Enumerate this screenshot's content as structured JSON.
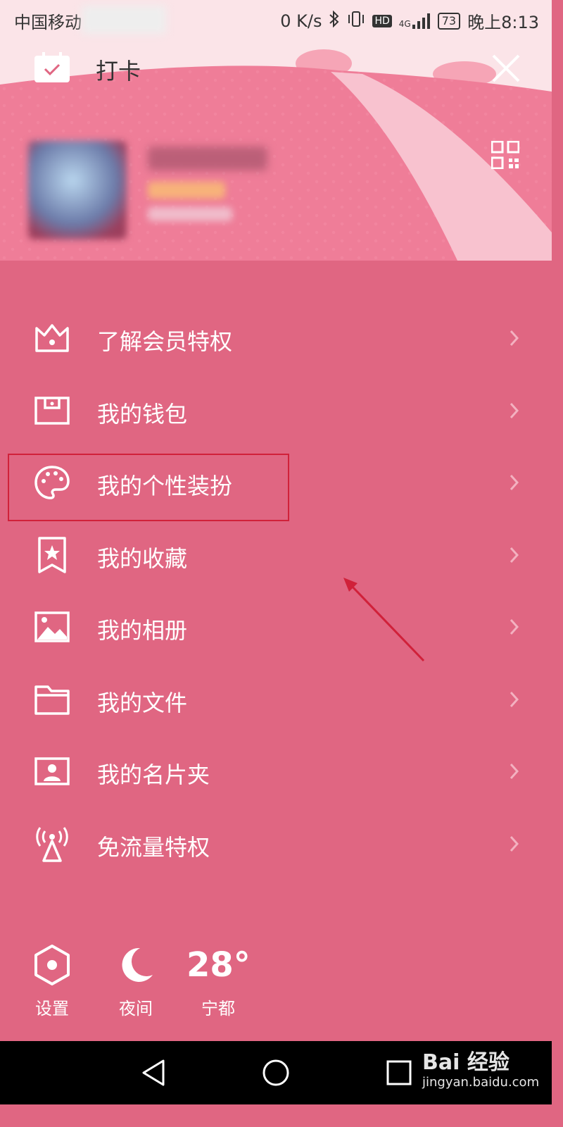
{
  "status_bar": {
    "carrier": "中国移动",
    "net_speed": "0 K/s",
    "hd_badge": "HD",
    "network_type": "4G",
    "battery": "73",
    "time": "晚上8:13"
  },
  "top_bar": {
    "checkin_label": "打卡"
  },
  "menu": {
    "items": [
      {
        "label": "了解会员特权",
        "icon": "crown-icon"
      },
      {
        "label": "我的钱包",
        "icon": "wallet-icon"
      },
      {
        "label": "我的个性装扮",
        "icon": "palette-icon"
      },
      {
        "label": "我的收藏",
        "icon": "bookmark-star-icon"
      },
      {
        "label": "我的相册",
        "icon": "photo-icon"
      },
      {
        "label": "我的文件",
        "icon": "folder-icon"
      },
      {
        "label": "我的名片夹",
        "icon": "contact-card-icon"
      },
      {
        "label": "免流量特权",
        "icon": "antenna-icon"
      }
    ]
  },
  "bottom_bar": {
    "settings_label": "设置",
    "night_label": "夜间",
    "temperature": "28°",
    "city": "宁都"
  },
  "watermark": {
    "brand": "Bai 经验",
    "url": "jingyan.baidu.com"
  },
  "colors": {
    "panel": "#e06682",
    "highlight_box": "#d0213a",
    "arrow": "#d0213a"
  }
}
